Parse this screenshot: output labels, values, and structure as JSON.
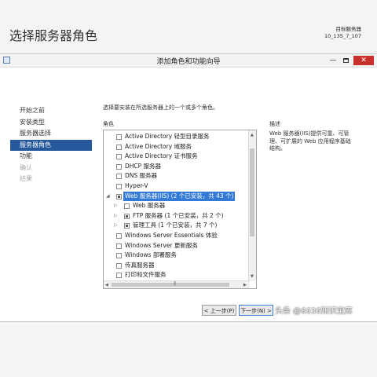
{
  "window": {
    "title": "添加角色和功能向导",
    "buttons": {
      "minimize": "—",
      "close": "✕"
    }
  },
  "page": {
    "heading": "选择服务器角色",
    "target_label": "目标服务器",
    "target_server": "10_135_7_107"
  },
  "nav": [
    {
      "label": "开始之前",
      "state": "normal"
    },
    {
      "label": "安装类型",
      "state": "normal"
    },
    {
      "label": "服务器选择",
      "state": "normal"
    },
    {
      "label": "服务器角色",
      "state": "active"
    },
    {
      "label": "功能",
      "state": "normal"
    },
    {
      "label": "确认",
      "state": "disabled"
    },
    {
      "label": "结果",
      "state": "disabled"
    }
  ],
  "main": {
    "instruction": "选择要安装在所选服务器上的一个或多个角色。",
    "roles_header": "角色",
    "description_header": "描述",
    "description_text": "Web 服务器(IIS)提供可靠、可管理、可扩展的 Web 应用程序基础结构。"
  },
  "roles": [
    {
      "label": "Active Directory 轻型目录服务"
    },
    {
      "label": "Active Directory 域服务"
    },
    {
      "label": "Active Directory 证书服务"
    },
    {
      "label": "DHCP 服务器"
    },
    {
      "label": "DNS 服务器"
    },
    {
      "label": "Hyper-V"
    },
    {
      "label": "Web 服务器(IIS) (2 个已安装，共 43 个)"
    },
    {
      "label": "Web 服务器"
    },
    {
      "label": "FTP 服务器 (1 个已安装，共 2 个)"
    },
    {
      "label": "管理工具 (1 个已安装，共 7 个)"
    },
    {
      "label": "Windows Server Essentials 体验"
    },
    {
      "label": "Windows Server 更新服务"
    },
    {
      "label": "Windows 部署服务"
    },
    {
      "label": "传真服务器"
    },
    {
      "label": "打印和文件服务"
    }
  ],
  "buttons": {
    "prev": "< 上一步(P)",
    "next": "下一步(N) >"
  },
  "watermark": "头条 @6636知识宝库"
}
